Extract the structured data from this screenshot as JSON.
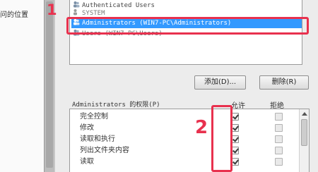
{
  "left_panel": {
    "label": "问的位置"
  },
  "users": [
    {
      "name": "Authenticated Users",
      "selected": false
    },
    {
      "name": "SYSTEM",
      "selected": false
    },
    {
      "name": "Administrators (WIN7-PC\\Administrators)",
      "selected": true
    },
    {
      "name": "Users (WIN7-PC\\Users)",
      "selected": false
    }
  ],
  "buttons": {
    "add": "添加(D)...",
    "remove": "删除(R)"
  },
  "permissions_header": {
    "label": "Administrators 的权限(P)",
    "allow": "允许",
    "deny": "拒绝"
  },
  "permissions": [
    {
      "name": "完全控制",
      "allow": true,
      "deny": false
    },
    {
      "name": "修改",
      "allow": true,
      "deny": false
    },
    {
      "name": "读取和执行",
      "allow": true,
      "deny": false
    },
    {
      "name": "列出文件夹内容",
      "allow": true,
      "deny": false
    },
    {
      "name": "读取",
      "allow": true,
      "deny": false
    }
  ],
  "annotations": {
    "step1": "1",
    "step2": "2"
  },
  "colors": {
    "annotation": "#e8314e",
    "selection": "#3399ff"
  }
}
